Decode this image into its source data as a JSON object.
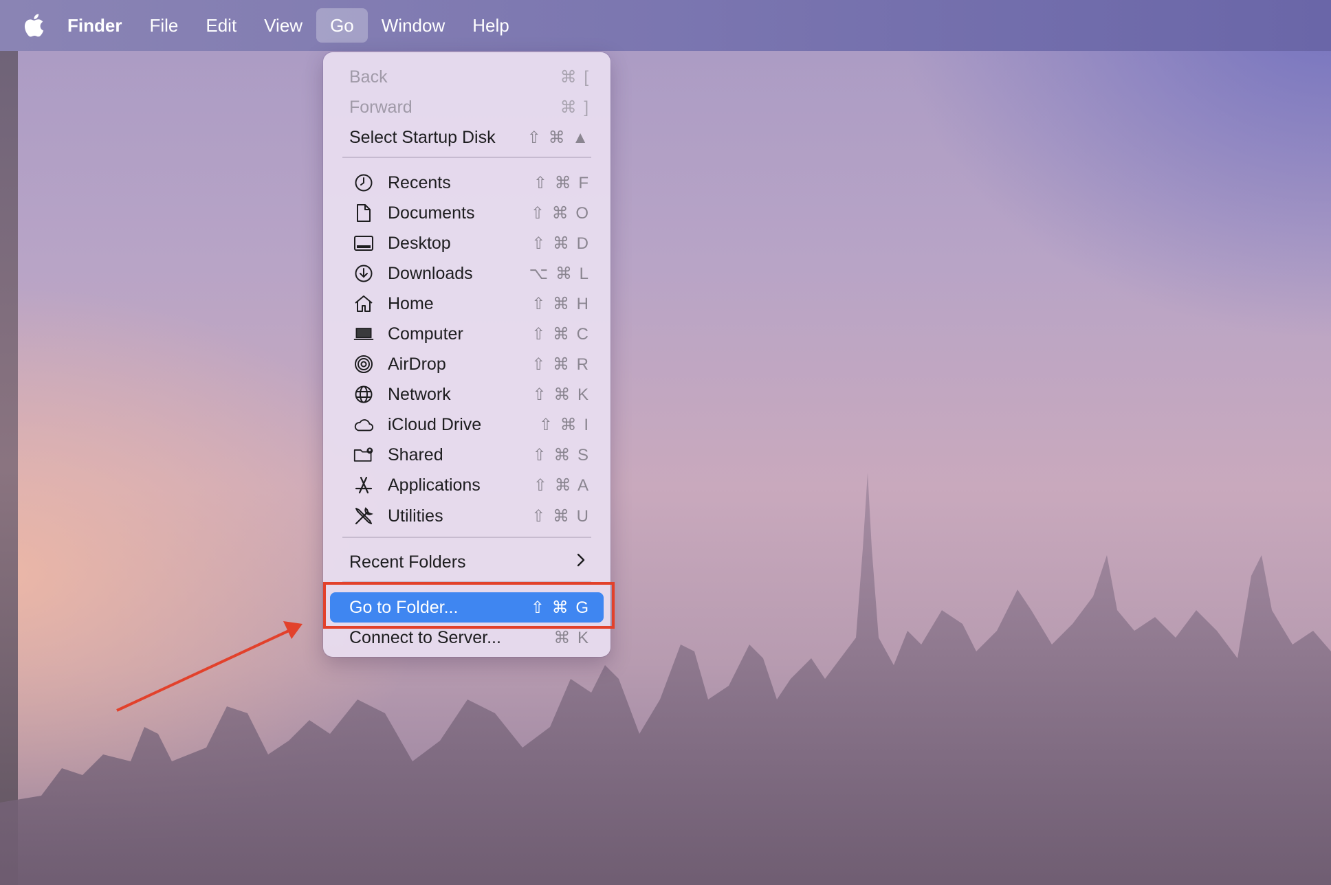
{
  "menubar": {
    "apple_icon": "apple-logo-icon",
    "items": [
      "Finder",
      "File",
      "Edit",
      "View",
      "Go",
      "Window",
      "Help"
    ],
    "active": "Go"
  },
  "go_menu": {
    "back": {
      "label": "Back",
      "shortcut": "⌘ ["
    },
    "forward": {
      "label": "Forward",
      "shortcut": "⌘ ]"
    },
    "startup": {
      "label": "Select Startup Disk",
      "shortcut": "⇧ ⌘ ▲"
    },
    "places": [
      {
        "label": "Recents",
        "shortcut": "⇧ ⌘ F",
        "icon": "clock-icon"
      },
      {
        "label": "Documents",
        "shortcut": "⇧ ⌘ O",
        "icon": "document-icon"
      },
      {
        "label": "Desktop",
        "shortcut": "⇧ ⌘ D",
        "icon": "desktop-icon"
      },
      {
        "label": "Downloads",
        "shortcut": "⌥ ⌘ L",
        "icon": "download-icon"
      },
      {
        "label": "Home",
        "shortcut": "⇧ ⌘ H",
        "icon": "home-icon"
      },
      {
        "label": "Computer",
        "shortcut": "⇧ ⌘ C",
        "icon": "laptop-icon"
      },
      {
        "label": "AirDrop",
        "shortcut": "⇧ ⌘ R",
        "icon": "airdrop-icon"
      },
      {
        "label": "Network",
        "shortcut": "⇧ ⌘ K",
        "icon": "globe-icon"
      },
      {
        "label": "iCloud Drive",
        "shortcut": "⇧ ⌘ I",
        "icon": "cloud-icon"
      },
      {
        "label": "Shared",
        "shortcut": "⇧ ⌘ S",
        "icon": "shared-folder-icon"
      },
      {
        "label": "Applications",
        "shortcut": "⇧ ⌘ A",
        "icon": "applications-icon"
      },
      {
        "label": "Utilities",
        "shortcut": "⇧ ⌘ U",
        "icon": "utilities-icon"
      }
    ],
    "recent_folders": {
      "label": "Recent Folders"
    },
    "go_to_folder": {
      "label": "Go to Folder...",
      "shortcut": "⇧ ⌘ G"
    },
    "connect_server": {
      "label": "Connect to Server...",
      "shortcut": "⌘ K"
    }
  },
  "colors": {
    "highlight": "#3f86f1",
    "annotation": "#e2412b"
  }
}
